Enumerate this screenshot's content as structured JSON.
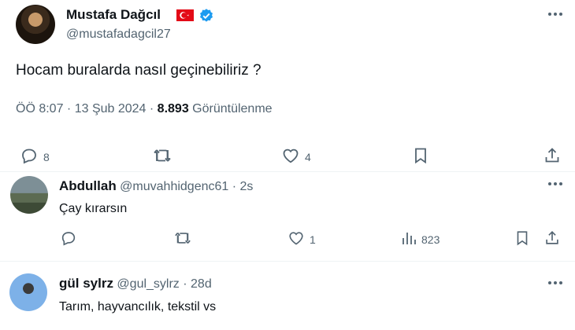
{
  "tweet": {
    "author_name": "Mustafa Dağcıl",
    "author_handle": "@mustafadagcil27",
    "text": "Hocam buralarda nasıl geçinebiliriz ?",
    "time": "ÖÖ 8:07 · 13 Şub 2024 · ",
    "views_count": "8.893",
    "views_label": " Görüntülenme",
    "replies": "8",
    "likes": "4",
    "flag_color": "#e30a17",
    "verified_color": "#1d9bf0"
  },
  "replies": [
    {
      "name": "Abdullah",
      "handle": "@muvahhidgenc61 · 2s",
      "text": "Çay kırarsın",
      "likes": "1",
      "views": "823"
    },
    {
      "name": "gül sylrz",
      "handle": "@gul_sylrz · 28d",
      "text": "Tarım,  hayvancılık, tekstil vs"
    }
  ]
}
